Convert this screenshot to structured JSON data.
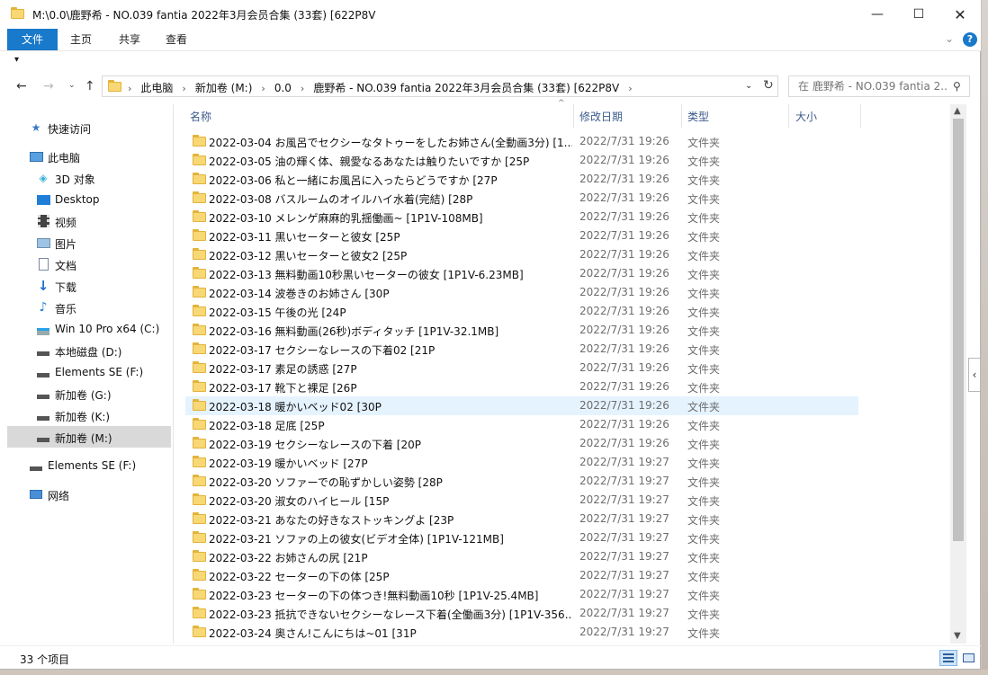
{
  "window": {
    "title": "M:\\0.0\\鹿野希 - NO.039 fantia 2022年3月会员合集 (33套) [622P8V",
    "minimize": "—",
    "maximize": "☐",
    "close": "✕"
  },
  "ribbon": {
    "tabs": [
      {
        "label": "文件"
      },
      {
        "label": "主页"
      },
      {
        "label": "共享"
      },
      {
        "label": "查看"
      }
    ],
    "help": "?",
    "expand": "⌄"
  },
  "qat": {
    "arrow": "▾"
  },
  "address": {
    "crumbs": [
      "此电脑",
      "新加卷 (M:)",
      "0.0",
      "鹿野希 - NO.039 fantia 2022年3月会员合集 (33套) [622P8V"
    ],
    "separator": "›"
  },
  "search": {
    "placeholder": "在 鹿野希 - NO.039 fantia 2..."
  },
  "nav_pane": {
    "items": [
      {
        "label": "快速访问",
        "icon": "star-icon"
      },
      {
        "label": "此电脑",
        "icon": "computer-icon"
      },
      {
        "label": "3D 对象",
        "icon": "cube-icon"
      },
      {
        "label": "Desktop",
        "icon": "desktop-icon"
      },
      {
        "label": "视频",
        "icon": "video-icon"
      },
      {
        "label": "图片",
        "icon": "picture-icon"
      },
      {
        "label": "文档",
        "icon": "document-icon"
      },
      {
        "label": "下载",
        "icon": "download-icon"
      },
      {
        "label": "音乐",
        "icon": "music-icon"
      },
      {
        "label": "Win 10 Pro x64 (C:)",
        "icon": "windows-drive-icon"
      },
      {
        "label": "本地磁盘 (D:)",
        "icon": "drive-icon"
      },
      {
        "label": "Elements SE (F:)",
        "icon": "drive-icon"
      },
      {
        "label": "新加卷 (G:)",
        "icon": "drive-icon"
      },
      {
        "label": "新加卷 (K:)",
        "icon": "drive-icon"
      },
      {
        "label": "新加卷 (M:)",
        "icon": "drive-icon",
        "selected": true
      },
      {
        "label": "Elements SE (F:)",
        "icon": "drive-icon"
      },
      {
        "label": "网络",
        "icon": "network-icon"
      }
    ]
  },
  "columns": {
    "name": "名称",
    "date": "修改日期",
    "type": "类型",
    "size": "大小"
  },
  "rows": [
    {
      "name": "2022-03-04 お風呂でセクシーなタトゥーをしたお姉さん(全動画3分) [1...",
      "date": "2022/7/31 19:26",
      "type": "文件夹"
    },
    {
      "name": "2022-03-05 油の輝く体、親愛なるあなたは触りたいですか [25P",
      "date": "2022/7/31 19:26",
      "type": "文件夹"
    },
    {
      "name": "2022-03-06 私と一緒にお風呂に入ったらどうですか [27P",
      "date": "2022/7/31 19:26",
      "type": "文件夹"
    },
    {
      "name": "2022-03-08 バスルームのオイルハイ水着(完結) [28P",
      "date": "2022/7/31 19:26",
      "type": "文件夹"
    },
    {
      "name": "2022-03-10 メレンゲ麻麻的乳揺働画~ [1P1V-108MB]",
      "date": "2022/7/31 19:26",
      "type": "文件夹"
    },
    {
      "name": "2022-03-11 黒いセーターと彼女 [25P",
      "date": "2022/7/31 19:26",
      "type": "文件夹"
    },
    {
      "name": "2022-03-12 黒いセーターと彼女2 [25P",
      "date": "2022/7/31 19:26",
      "type": "文件夹"
    },
    {
      "name": "2022-03-13 無料動画10秒黒いセーターの彼女 [1P1V-6.23MB]",
      "date": "2022/7/31 19:26",
      "type": "文件夹"
    },
    {
      "name": "2022-03-14 波巻きのお姉さん [30P",
      "date": "2022/7/31 19:26",
      "type": "文件夹"
    },
    {
      "name": "2022-03-15 午後の光 [24P",
      "date": "2022/7/31 19:26",
      "type": "文件夹"
    },
    {
      "name": "2022-03-16 無料動画(26秒)ボディタッチ [1P1V-32.1MB]",
      "date": "2022/7/31 19:26",
      "type": "文件夹"
    },
    {
      "name": "2022-03-17 セクシーなレースの下着02 [21P",
      "date": "2022/7/31 19:26",
      "type": "文件夹"
    },
    {
      "name": "2022-03-17 素足の誘惑 [27P",
      "date": "2022/7/31 19:26",
      "type": "文件夹"
    },
    {
      "name": "2022-03-17 靴下と裸足 [26P",
      "date": "2022/7/31 19:26",
      "type": "文件夹"
    },
    {
      "name": "2022-03-18 暖かいベッド02 [30P",
      "date": "2022/7/31 19:26",
      "type": "文件夹",
      "hover": true
    },
    {
      "name": "2022-03-18 足底 [25P",
      "date": "2022/7/31 19:26",
      "type": "文件夹"
    },
    {
      "name": "2022-03-19 セクシーなレースの下着 [20P",
      "date": "2022/7/31 19:26",
      "type": "文件夹"
    },
    {
      "name": "2022-03-19 暖かいベッド [27P",
      "date": "2022/7/31 19:27",
      "type": "文件夹"
    },
    {
      "name": "2022-03-20 ソファーでの恥ずかしい姿勢 [28P",
      "date": "2022/7/31 19:27",
      "type": "文件夹"
    },
    {
      "name": "2022-03-20 淑女のハイヒール [15P",
      "date": "2022/7/31 19:27",
      "type": "文件夹"
    },
    {
      "name": "2022-03-21 あなたの好きなストッキングよ [23P",
      "date": "2022/7/31 19:27",
      "type": "文件夹"
    },
    {
      "name": "2022-03-21 ソファの上の彼女(ビデオ全体) [1P1V-121MB]",
      "date": "2022/7/31 19:27",
      "type": "文件夹"
    },
    {
      "name": "2022-03-22 お姉さんの尻 [21P",
      "date": "2022/7/31 19:27",
      "type": "文件夹"
    },
    {
      "name": "2022-03-22 セーターの下の体 [25P",
      "date": "2022/7/31 19:27",
      "type": "文件夹"
    },
    {
      "name": "2022-03-23 セーターの下の体つき!無料動画10秒 [1P1V-25.4MB]",
      "date": "2022/7/31 19:27",
      "type": "文件夹"
    },
    {
      "name": "2022-03-23 抵抗できないセクシーなレース下着(全働画3分) [1P1V-356...",
      "date": "2022/7/31 19:27",
      "type": "文件夹"
    },
    {
      "name": "2022-03-24 奥さん!こんにちは~01 [31P",
      "date": "2022/7/31 19:27",
      "type": "文件夹"
    }
  ],
  "status": {
    "count": "33 个项目"
  },
  "colors": {
    "accent": "#1979ca",
    "hover_row": "#e5f3ff",
    "selected_nav": "#d9d9d9"
  }
}
